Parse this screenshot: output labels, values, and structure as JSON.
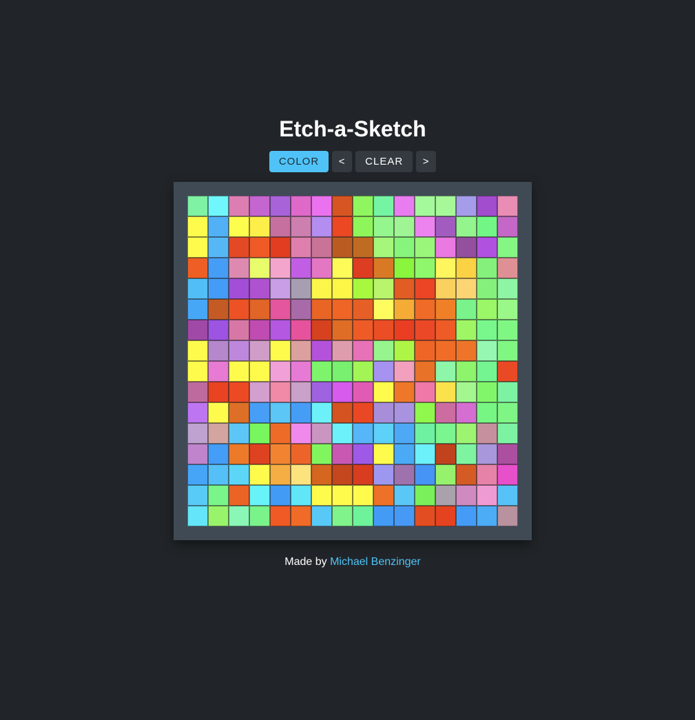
{
  "title": "Etch-a-Sketch",
  "controls": {
    "color_label": "COLOR",
    "prev_label": "<",
    "clear_label": "CLEAR",
    "next_label": ">",
    "active_color": "#4fc3f7"
  },
  "footer": {
    "prefix": "Made by ",
    "author": "Michael Benzinger",
    "link_color": "#4fc3f7"
  },
  "grid": {
    "rows": 16,
    "cols": 16,
    "cells": [
      [
        "#7ff2a3",
        "#6ff7fb",
        "#dd7eb3",
        "#c565d0",
        "#a963d9",
        "#de69c9",
        "#ea72ef",
        "#d75522",
        "#8ff65f",
        "#75f4a3",
        "#e97cf1",
        "#a4f99b",
        "#a6f899",
        "#a59de9",
        "#a24cce",
        "#ea8db5"
      ],
      [
        "#fefb4d",
        "#52b1f6",
        "#fdfd4e",
        "#fdee49",
        "#c670a0",
        "#cd7fb0",
        "#b38df0",
        "#ec4824",
        "#8ef65b",
        "#95f68d",
        "#9ff593",
        "#ec83ef",
        "#a25cc0",
        "#94f58e",
        "#72f685",
        "#c467c6"
      ],
      [
        "#fefb4d",
        "#55b8f5",
        "#e44925",
        "#f05a27",
        "#e23d20",
        "#de7fad",
        "#c87397",
        "#ba5c22",
        "#c06b22",
        "#a6f67c",
        "#87f57b",
        "#9af67a",
        "#ea79e2",
        "#944f9f",
        "#b151e0",
        "#85f684"
      ],
      [
        "#ee5f25",
        "#469df6",
        "#de8ab0",
        "#e9fc6b",
        "#f4a5cc",
        "#c25ee4",
        "#e477c4",
        "#fefb59",
        "#dd3e22",
        "#d97926",
        "#89f53d",
        "#8ff76b",
        "#fef65c",
        "#fbd244",
        "#85f17c",
        "#df9095"
      ],
      [
        "#51bff6",
        "#449cf6",
        "#a24ed7",
        "#af52cf",
        "#c99ee7",
        "#a79fb1",
        "#fdf64a",
        "#fdf647",
        "#a8f840",
        "#b9f46d",
        "#e15d24",
        "#ea4625",
        "#fad15f",
        "#fbd574",
        "#85f17c",
        "#8ef5a4"
      ],
      [
        "#46a7f6",
        "#c45b24",
        "#ec5226",
        "#e06526",
        "#e4569e",
        "#a86aa8",
        "#e86526",
        "#ef6526",
        "#e65f27",
        "#fffc5f",
        "#f5ac36",
        "#ef6b27",
        "#f08028",
        "#79f38a",
        "#9bf668",
        "#9af888"
      ],
      [
        "#a049a7",
        "#9d54e2",
        "#d777a6",
        "#c04cb1",
        "#b458e2",
        "#e6539c",
        "#d6411f",
        "#df6d26",
        "#ef5b27",
        "#eb4e25",
        "#e93e22",
        "#ea4826",
        "#ef5b27",
        "#9ff665",
        "#79f78c",
        "#80f783"
      ],
      [
        "#fefb4d",
        "#b488ca",
        "#bd87dc",
        "#cf9dc7",
        "#fefb4d",
        "#dca09e",
        "#b452db",
        "#dd9dad",
        "#e772b8",
        "#96f58c",
        "#aef645",
        "#ef6526",
        "#ef6d27",
        "#ee742a",
        "#95f7b1",
        "#80f783"
      ],
      [
        "#fefb4d",
        "#e77ad2",
        "#fefb4d",
        "#fefb4d",
        "#f2a0d8",
        "#e77ad5",
        "#7ef46d",
        "#79f06f",
        "#a3f455",
        "#a692f0",
        "#f2a0bd",
        "#e77228",
        "#8df6a8",
        "#8df46b",
        "#74f591",
        "#e94a25"
      ],
      [
        "#bf6a9f",
        "#ea4322",
        "#ec4925",
        "#d29fce",
        "#f08aa7",
        "#c9a1c9",
        "#9f62e1",
        "#d75bec",
        "#e15bb4",
        "#fefb4d",
        "#ef7729",
        "#ee78a7",
        "#fbe24d",
        "#a4f690",
        "#82f66b",
        "#7ef2a3"
      ],
      [
        "#bd75f2",
        "#fefb4d",
        "#dd6f27",
        "#479ef6",
        "#5cc6f7",
        "#469df6",
        "#6cf1fa",
        "#d55320",
        "#ea4824",
        "#a88ed9",
        "#a993e1",
        "#90f74c",
        "#cc6ca0",
        "#d56ed1",
        "#77f683",
        "#7ff586"
      ],
      [
        "#bea2cf",
        "#d3a4a0",
        "#5dc6f7",
        "#78f65e",
        "#ee6b27",
        "#f089ec",
        "#ca95c0",
        "#6cf1fa",
        "#57b6f7",
        "#5dd1f7",
        "#4da9f6",
        "#6ef2a1",
        "#7bf58f",
        "#9df471",
        "#c7909f",
        "#7ef2a3"
      ],
      [
        "#bf84cc",
        "#449df6",
        "#ec7a29",
        "#df4221",
        "#f28431",
        "#ec6429",
        "#81f55e",
        "#c858b2",
        "#9e5ae6",
        "#fefb4d",
        "#4baaf6",
        "#6cf0f9",
        "#c0431d",
        "#7ef4a0",
        "#a997db",
        "#ad4fa0"
      ],
      [
        "#46a5f6",
        "#55c0f7",
        "#5cd5f7",
        "#fefb4d",
        "#f4ae44",
        "#fce37d",
        "#d5661f",
        "#c4471e",
        "#d93d20",
        "#9d97f0",
        "#9e72ad",
        "#4694f4",
        "#96f26c",
        "#d55b24",
        "#e682a8",
        "#e74fcb"
      ],
      [
        "#58cbf6",
        "#7af58a",
        "#ec6326",
        "#68f3f8",
        "#429cf6",
        "#60e6f7",
        "#fefb4d",
        "#fefb4d",
        "#fefb4d",
        "#ee7129",
        "#5bc7f6",
        "#7af05b",
        "#a9a2ad",
        "#d08ac2",
        "#ef9bd3",
        "#57c2f7"
      ],
      [
        "#64e6f8",
        "#98f56b",
        "#8af7b6",
        "#7af38b",
        "#ef5a25",
        "#ef6b27",
        "#58c9f7",
        "#80f38b",
        "#6ef39b",
        "#439bf6",
        "#4799f6",
        "#e24d22",
        "#e5431f",
        "#449cf7",
        "#4cacf6",
        "#b8929e"
      ]
    ]
  }
}
